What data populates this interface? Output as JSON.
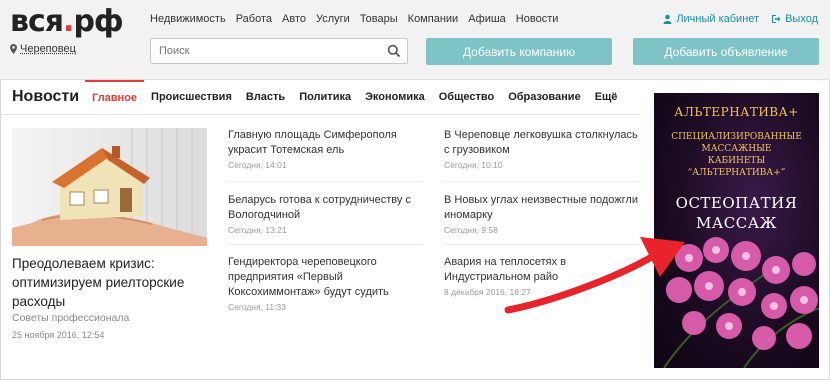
{
  "header": {
    "logo_text": "вся",
    "logo_dot": ".",
    "logo_suffix": "рф",
    "nav": [
      "Недвижимость",
      "Работа",
      "Авто",
      "Услуги",
      "Товары",
      "Компании",
      "Афиша",
      "Новости"
    ],
    "cabinet_label": "Личный кабинет",
    "logout_label": "Выход",
    "city": "Череповец",
    "search_placeholder": "Поиск",
    "add_company_label": "Добавить компанию",
    "add_ad_label": "Добавить объявление"
  },
  "news_section": {
    "title": "Новости",
    "tabs": [
      "Главное",
      "Происшествия",
      "Власть",
      "Политика",
      "Экономика",
      "Общество",
      "Образование",
      "Ещё"
    ],
    "active_tab": "Главное",
    "featured": {
      "title": "Преодолеваем кризис: оптимизируем риелторские расходы",
      "source": "Советы профессионала",
      "date": "25 ноября 2016, 12:54"
    },
    "column1": [
      {
        "title": "Главную площадь Симферополя украсит Тотемская ель",
        "date": "Сегодня, 14:01"
      },
      {
        "title": "Беларусь готова к сотрудничеству с Вологодчиной",
        "date": "Сегодня, 13:21"
      },
      {
        "title": "Гендиректора череповецкого предприятия «Первый Коксохиммонтаж» будут судить",
        "date": "Сегодня, 11:33"
      }
    ],
    "column2": [
      {
        "title": "В Череповце легковушка столкнулась с грузовиком",
        "date": "Сегодня, 10:10"
      },
      {
        "title": "В Новых углах неизвестные подожгли иномарку",
        "date": "Сегодня, 9:58"
      },
      {
        "title": "Авария на теплосетях в Индустриальном райо",
        "date": "8 декабря 2016, 16:27"
      }
    ]
  },
  "ad_banner": {
    "brand": "АЛЬТЕРНАТИВА+",
    "subtitle_lines": [
      "СПЕЦИАЛИЗИРОВАННЫЕ",
      "МАССАЖНЫЕ",
      "КАБИНЕТЫ",
      "“АЛЬТЕРНАТИВА+”"
    ],
    "main_lines": [
      "ОСТЕОПАТИЯ",
      "МАССАЖ"
    ]
  },
  "colors": {
    "accent_red": "#e23b3b",
    "teal_button": "#7ec3c6",
    "link_teal": "#1b8fa3",
    "ad_gold": "#f3c35a",
    "arrow_red": "#e8232a"
  },
  "icons": {
    "user": "user-icon",
    "logout": "logout-icon",
    "location": "location-pin-icon",
    "search": "search-icon"
  }
}
